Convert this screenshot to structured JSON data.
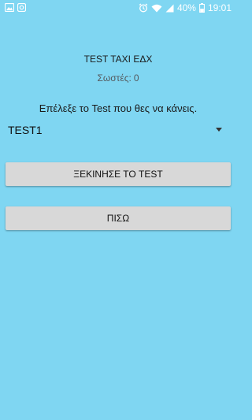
{
  "status_bar": {
    "battery": "40%",
    "time": "19:01",
    "icons_left": [
      "image-icon",
      "notification-app-icon"
    ],
    "icons_right": [
      "alarm-icon",
      "wifi-icon",
      "signal-icon",
      "battery-icon"
    ]
  },
  "header": {
    "title": "TEST TAXI ΕΔΧ",
    "score_label": "Σωστές:",
    "score_value": "0"
  },
  "main": {
    "instruction": "Επέλεξε το Test που θες να κάνεις.",
    "spinner_selected": "TEST1",
    "start_button": "ΞΕΚΙΝΗΣΕ ΤΟ TEST",
    "back_button": "ΠΙΣΩ"
  },
  "colors": {
    "background": "#7fd6f2",
    "button": "#d8d8d8",
    "status_text": "#ffffff"
  }
}
